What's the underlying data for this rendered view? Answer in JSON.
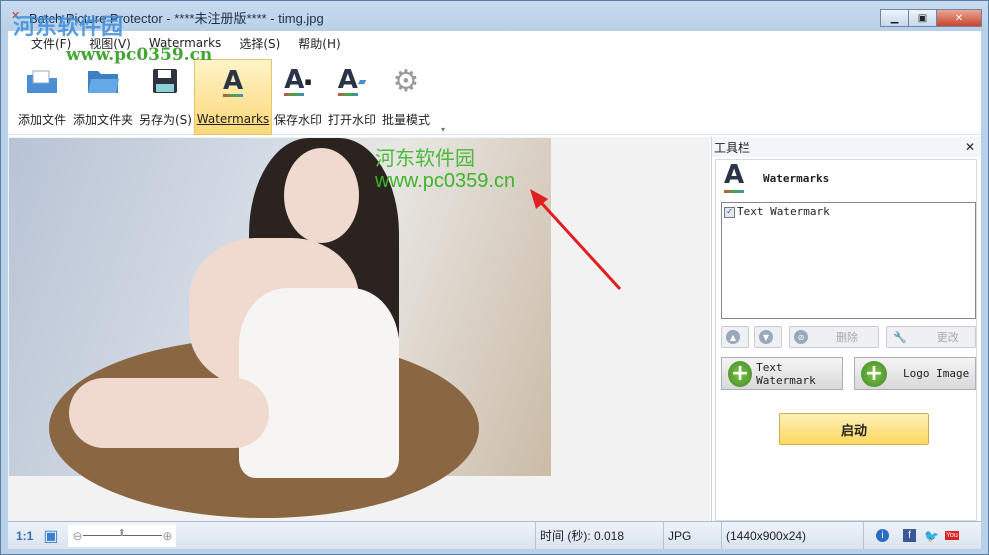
{
  "window": {
    "title": "Batch Picture Protector - ****未注册版**** - timg.jpg"
  },
  "menu": [
    "文件(F)",
    "视图(V)",
    "Watermarks",
    "选择(S)",
    "帮助(H)"
  ],
  "toolbar": [
    {
      "label": "添加文件",
      "icon": "add-file-icon"
    },
    {
      "label": "添加文件夹",
      "icon": "add-folder-icon"
    },
    {
      "label": "另存为(S)",
      "icon": "save-icon"
    },
    {
      "label": "Watermarks",
      "icon": "watermark-icon"
    },
    {
      "label": "保存水印",
      "icon": "save-watermark-icon"
    },
    {
      "label": "打开水印",
      "icon": "open-watermark-icon"
    },
    {
      "label": "批量模式",
      "icon": "gear-icon"
    }
  ],
  "image_watermark": {
    "line1": "河东软件园",
    "line2": "www.pc0359.cn",
    "color": "#3cb52c"
  },
  "site_overlay": {
    "name": "河东软件园",
    "url": "www.pc0359.cn"
  },
  "panel": {
    "title": "工具栏",
    "heading": "Watermarks",
    "items": [
      {
        "label": "Text Watermark",
        "checked": true
      }
    ],
    "delete_label": "删除",
    "edit_label": "更改",
    "add_text_label": "Text Watermark",
    "add_logo_label": "Logo Image",
    "start_label": "启动"
  },
  "status": {
    "zoom_actual": "1:1",
    "time": "时间 (秒): 0.018",
    "format": "JPG",
    "dimensions": "(1440x900x24)",
    "zoom_level": 0.5
  }
}
